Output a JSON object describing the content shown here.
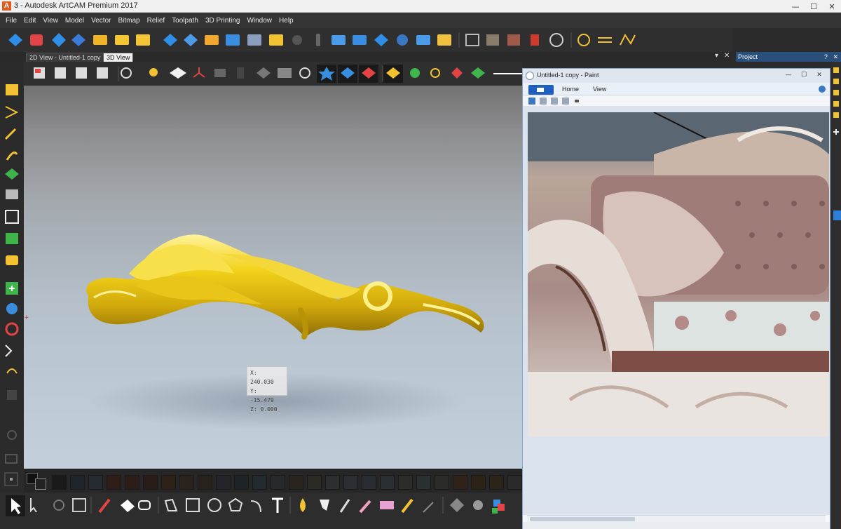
{
  "window": {
    "title": "3 - Autodesk ArtCAM Premium 2017",
    "logo_letter": "A",
    "minimize": "—",
    "maximize": "☐",
    "close": "✕"
  },
  "menu": [
    "File",
    "Edit",
    "View",
    "Model",
    "Vector",
    "Bitmap",
    "Relief",
    "Toolpath",
    "3D Printing",
    "Window",
    "Help"
  ],
  "tabs": [
    {
      "label": "2D View - Untitled-1 copy",
      "active": false
    },
    {
      "label": "3D View",
      "active": true
    }
  ],
  "tabs_controls": {
    "dropdown": "▾",
    "close": "✕"
  },
  "project_panel": {
    "title": "Project",
    "help": "?",
    "close": "✕"
  },
  "viewport": {
    "coords": {
      "x": "X: 240.030",
      "y": "Y: -15.479",
      "z": "Z: 0.000"
    },
    "model_color": "#f2d21a",
    "axis_marker": "+"
  },
  "palette": {
    "swatches": [
      "#1a1a1a",
      "#20252c",
      "#262a31",
      "#2e1e17",
      "#2c1d19",
      "#2a1c16",
      "#2d2218",
      "#2a221b",
      "#28221c",
      "#24242a",
      "#1e2328",
      "#232a2e",
      "#262a2d",
      "#2a241e",
      "#2c2a24",
      "#2b2d2f",
      "#2a2e33",
      "#292d31",
      "#2b2e30",
      "#2c2d2b",
      "#2a2f31",
      "#2b2c2a",
      "#302218",
      "#2d2216",
      "#2b241a",
      "#2a2a2a"
    ]
  },
  "paint": {
    "title": "Untitled-1 copy - Paint",
    "minimize": "—",
    "maximize": "☐",
    "close": "✕",
    "ribbon_tabs": [
      "Home",
      "View"
    ]
  }
}
